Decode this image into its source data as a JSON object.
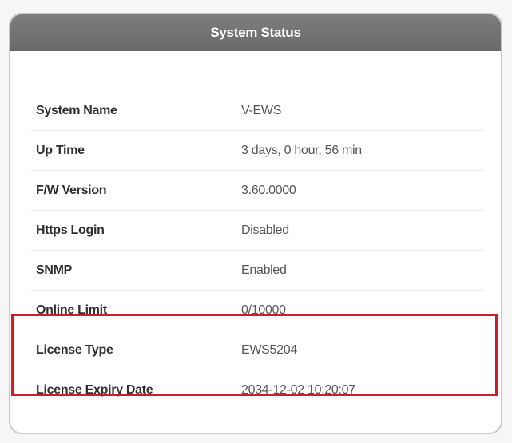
{
  "panel": {
    "title": "System Status"
  },
  "rows": [
    {
      "label": "System Name",
      "value": "V-EWS"
    },
    {
      "label": "Up Time",
      "value": "3 days, 0 hour, 56 min"
    },
    {
      "label": "F/W Version",
      "value": "3.60.0000"
    },
    {
      "label": "Https Login",
      "value": "Disabled"
    },
    {
      "label": "SNMP",
      "value": "Enabled"
    },
    {
      "label": "Online Limit",
      "value": "0/10000"
    },
    {
      "label": "License Type",
      "value": "EWS5204"
    },
    {
      "label": "License Expiry Date",
      "value": "2034-12-02 10:20:07"
    }
  ],
  "colors": {
    "header_bg": "#707070",
    "highlight_border": "#cc1f2a"
  }
}
